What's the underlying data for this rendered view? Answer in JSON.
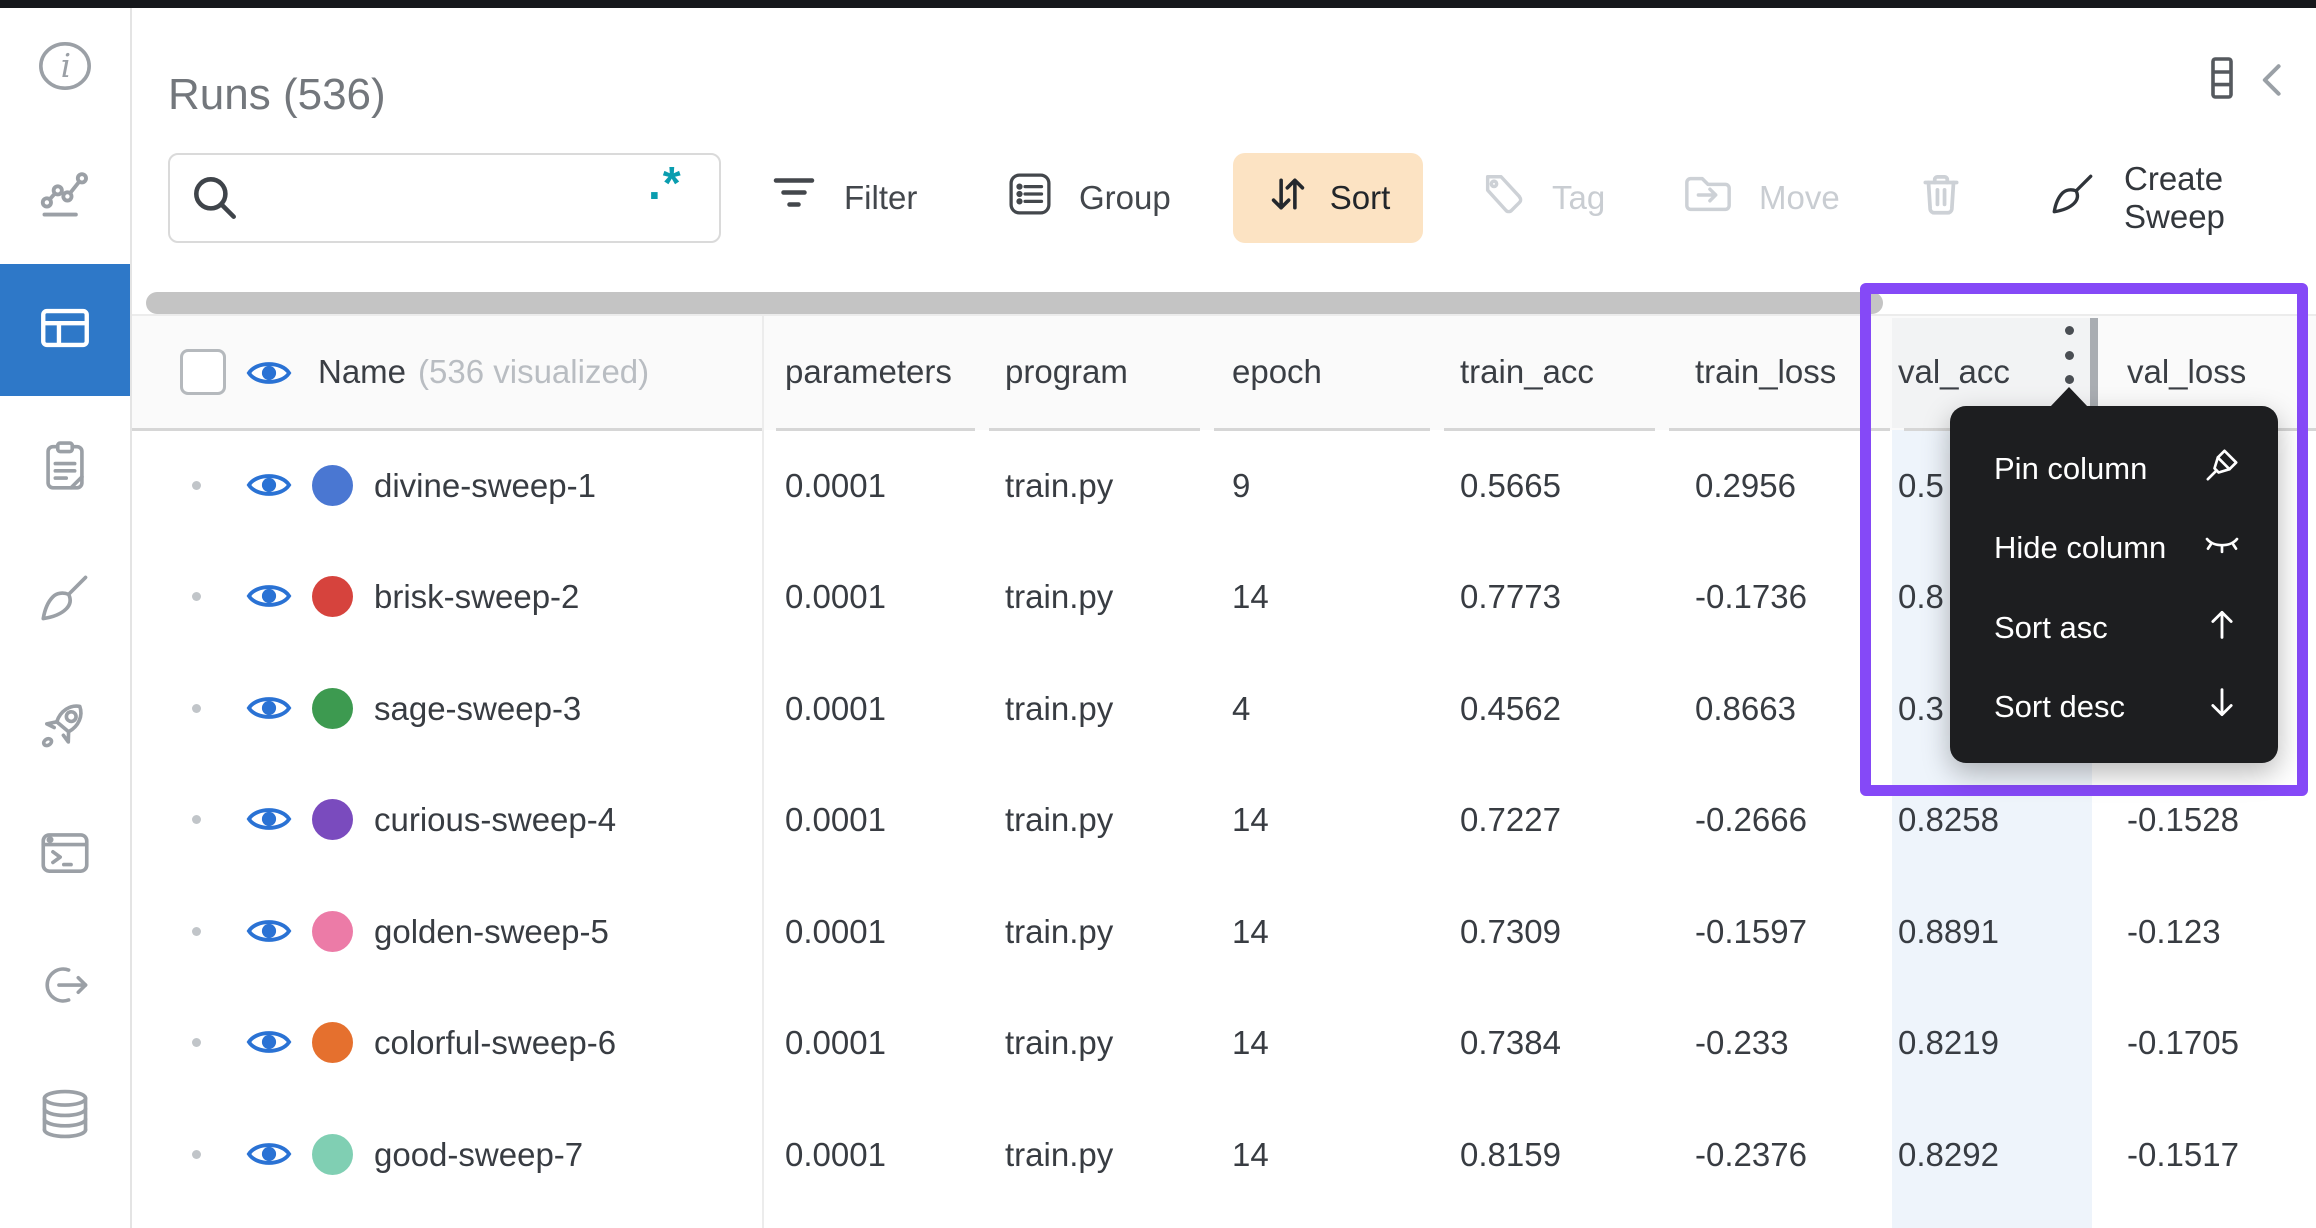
{
  "app": {
    "title": "Runs (536)"
  },
  "header_icons": [
    "columns-icon",
    "collapse-chevron-icon"
  ],
  "sidebar_icons": [
    "info-icon",
    "line-chart-icon",
    "table-icon",
    "clipboard-icon",
    "broom-icon",
    "rocket-icon",
    "terminal-icon",
    "export-arrow-icon",
    "database-icon"
  ],
  "toolbar": {
    "search": {
      "value": "",
      "placeholder": "",
      "regex_label": ".*"
    },
    "filter_label": "Filter",
    "group_label": "Group",
    "sort_label": "Sort",
    "tag_label": "Tag",
    "move_label": "Move",
    "create_sweep_label": "Create Sweep"
  },
  "table": {
    "name_header": {
      "label": "Name",
      "suffix": "(536 visualized)"
    },
    "columns": [
      "parameters",
      "program",
      "epoch",
      "train_acc",
      "train_loss",
      "val_acc",
      "val_loss"
    ],
    "rows": [
      {
        "name": "divine-sweep-1",
        "color": "#4a77d2",
        "parameters": "0.0001",
        "program": "train.py",
        "epoch": "9",
        "train_acc": "0.5665",
        "train_loss": "0.2956",
        "val_acc": "0.5",
        "val_loss": ""
      },
      {
        "name": "brisk-sweep-2",
        "color": "#d6433d",
        "parameters": "0.0001",
        "program": "train.py",
        "epoch": "14",
        "train_acc": "0.7773",
        "train_loss": "-0.1736",
        "val_acc": "0.8",
        "val_loss": ""
      },
      {
        "name": "sage-sweep-3",
        "color": "#3d9a50",
        "parameters": "0.0001",
        "program": "train.py",
        "epoch": "4",
        "train_acc": "0.4562",
        "train_loss": "0.8663",
        "val_acc": "0.3",
        "val_loss": ""
      },
      {
        "name": "curious-sweep-4",
        "color": "#7a4bbe",
        "parameters": "0.0001",
        "program": "train.py",
        "epoch": "14",
        "train_acc": "0.7227",
        "train_loss": "-0.2666",
        "val_acc": "0.8258",
        "val_loss": "-0.1528"
      },
      {
        "name": "golden-sweep-5",
        "color": "#ec7ba7",
        "parameters": "0.0001",
        "program": "train.py",
        "epoch": "14",
        "train_acc": "0.7309",
        "train_loss": "-0.1597",
        "val_acc": "0.8891",
        "val_loss": "-0.123"
      },
      {
        "name": "colorful-sweep-6",
        "color": "#e5702e",
        "parameters": "0.0001",
        "program": "train.py",
        "epoch": "14",
        "train_acc": "0.7384",
        "train_loss": "-0.233",
        "val_acc": "0.8219",
        "val_loss": "-0.1705"
      },
      {
        "name": "good-sweep-7",
        "color": "#80cfb3",
        "parameters": "0.0001",
        "program": "train.py",
        "epoch": "14",
        "train_acc": "0.8159",
        "train_loss": "-0.2376",
        "val_acc": "0.8292",
        "val_loss": "-0.1517"
      }
    ]
  },
  "context_menu": {
    "items": [
      {
        "label": "Pin column",
        "icon": "pin-icon"
      },
      {
        "label": "Hide column",
        "icon": "hide-column-icon"
      },
      {
        "label": "Sort asc",
        "icon": "arrow-up-icon"
      },
      {
        "label": "Sort desc",
        "icon": "arrow-down-icon"
      }
    ]
  },
  "colors": {
    "highlight_purple": "#8549f7",
    "sort_button_bg": "#fce3c3",
    "sidebar_active_bg": "#2e78c8",
    "eye_blue": "#2a72d4",
    "regex_teal": "#0a9daf",
    "val_acc_column_tint": "#eef4fb"
  }
}
